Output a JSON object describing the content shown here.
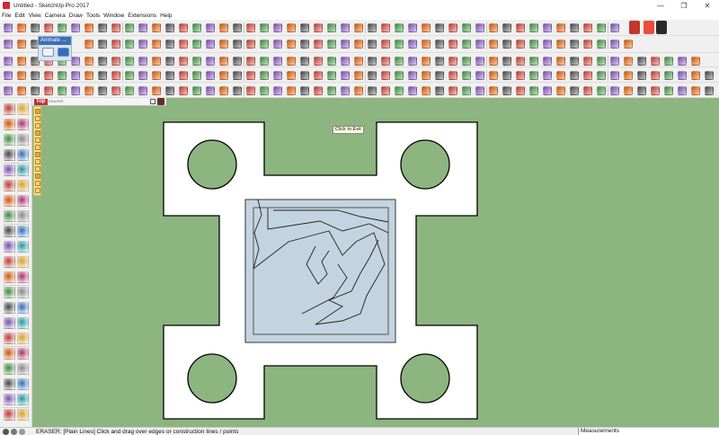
{
  "window": {
    "title": "Untitled - SketchUp Pro 2017",
    "minimize": "—",
    "restore": "❐",
    "close": "✕"
  },
  "menu": [
    "File",
    "Edit",
    "View",
    "Camera",
    "Draw",
    "Tools",
    "Window",
    "Extensions",
    "Help"
  ],
  "animate_panel": {
    "title": "Animate ..."
  },
  "views_panel": {
    "label": "Top",
    "sublabel": "ERASER"
  },
  "tooltip": "Click to Exit",
  "status": {
    "message": "ERASER: [Plain Lines] Click and drag over edges or construction lines / points",
    "measurements_label": "Measurements"
  },
  "colors": {
    "viewport": "#8db580",
    "plate_fill": "#ffffff",
    "sketch_fill": "#c3d4e0",
    "edge": "#000000"
  },
  "icons": [
    "sketchup-logo-icon",
    "select-arrow-icon",
    "eraser-icon",
    "pencil-icon",
    "rectangle-icon",
    "circle-icon",
    "arc-icon",
    "push-pull-icon",
    "move-icon",
    "rotate-icon",
    "tape-measure-icon",
    "paint-bucket-icon",
    "orbit-icon",
    "pan-icon",
    "zoom-icon",
    "walk-icon"
  ]
}
